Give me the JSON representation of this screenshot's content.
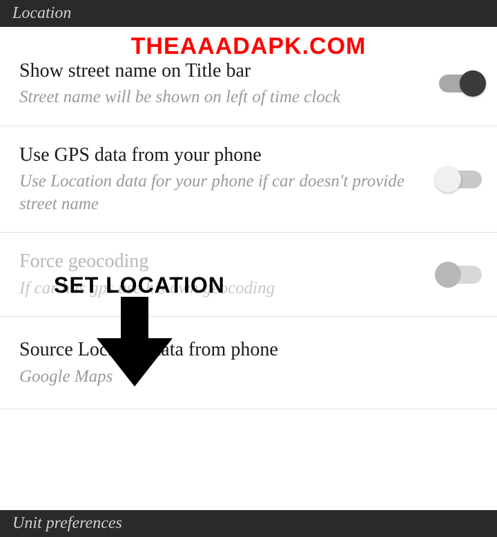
{
  "watermark": "THEAAADAPK.COM",
  "section1": {
    "header": "Location"
  },
  "settings": {
    "streetName": {
      "title": "Show street name on Title bar",
      "subtitle": "Street name will be shown on left of time clock",
      "enabled": true
    },
    "gpsData": {
      "title": "Use GPS data from your phone",
      "subtitle": "Use Location data for your phone if car doesn't provide street name",
      "enabled": false
    },
    "forceGeocoding": {
      "title": "Force geocoding",
      "subtitle": "If car has gps use his own geocoding",
      "disabled": true
    },
    "sourceLocation": {
      "title": "Source Location data from phone",
      "subtitle": "Google Maps"
    }
  },
  "annotation": {
    "label": "SET LOCATION"
  },
  "section2": {
    "header": "Unit preferences"
  }
}
